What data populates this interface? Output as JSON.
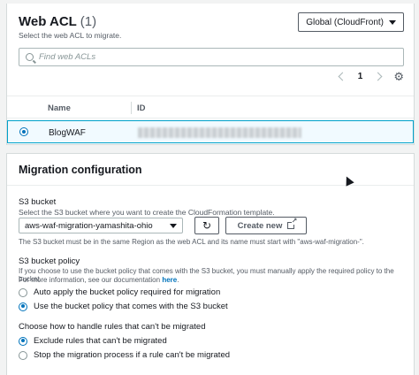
{
  "web_acl": {
    "title": "Web ACL",
    "count": "(1)",
    "subtitle": "Select the web ACL to migrate.",
    "region_button": "Global (CloudFront)",
    "search_placeholder": "Find web ACLs",
    "pagination": {
      "current_page": "1"
    },
    "table": {
      "columns": [
        "Name",
        "ID"
      ],
      "rows": [
        {
          "name": "BlogWAF",
          "selected": true
        }
      ]
    }
  },
  "migration": {
    "title": "Migration configuration",
    "s3_bucket": {
      "label": "S3 bucket",
      "description": "Select the S3 bucket where you want to create the CloudFormation template.",
      "selected_value": "aws-waf-migration-yamashita-ohio",
      "create_new_label": "Create new",
      "constraint_text": "The S3 bucket must be in the same Region as the web ACL and its name must start with \"aws-waf-migration-\"."
    },
    "bucket_policy": {
      "label": "S3 bucket policy",
      "description_line1": "If you choose to use the bucket policy that comes with the S3 bucket, you must manually apply the required policy to the bucket.",
      "description_line2_prefix": "For more information, see our documentation ",
      "description_link": "here",
      "description_line2_suffix": ".",
      "options": [
        {
          "label": "Auto apply the bucket policy required for migration",
          "selected": false
        },
        {
          "label": "Use the bucket policy that comes with the S3 bucket",
          "selected": true
        }
      ]
    },
    "rules_handling": {
      "label": "Choose how to handle rules that can't be migrated",
      "options": [
        {
          "label": "Exclude rules that can't be migrated",
          "selected": true
        },
        {
          "label": "Stop the migration process if a rule can't be migrated",
          "selected": false
        }
      ]
    }
  },
  "colors": {
    "accent": "#0073bb",
    "selected_row_border": "#00a1c9",
    "selected_row_bg": "#f1faff"
  }
}
